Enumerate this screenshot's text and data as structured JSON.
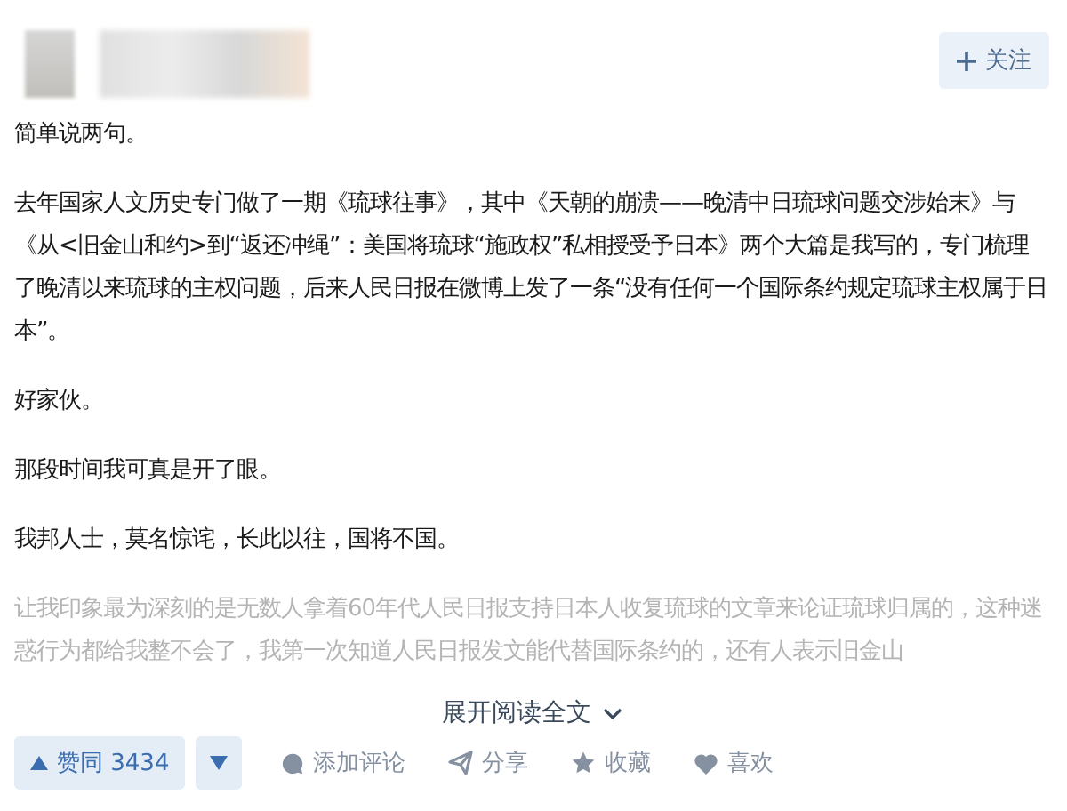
{
  "author": {
    "follow_label": "关注"
  },
  "paragraphs": [
    {
      "kind": "normal",
      "text": "简单说两句。"
    },
    {
      "kind": "normal",
      "text": "去年国家人文历史专门做了一期《琉球往事》，其中《天朝的崩溃——晚清中日琉球问题交涉始末》与《从<旧金山和约>到“返还冲绳”：美国将琉球“施政权”私相授受予日本》两个大篇是我写的，专门梳理了晚清以来琉球的主权问题，后来人民日报在微博上发了一条“没有任何一个国际条约规定琉球主权属于日本”。"
    },
    {
      "kind": "normal",
      "text": "好家伙。"
    },
    {
      "kind": "normal",
      "text": "那段时间我可真是开了眼。"
    },
    {
      "kind": "normal",
      "text": "我邦人士，莫名惊诧，长此以往，国将不国。"
    },
    {
      "kind": "faded",
      "text": "让我印象最为深刻的是无数人拿着60年代人民日报支持日本人收复琉球的文章来论证琉球归属的，这种迷惑行为都给我整不会了，我第一次知道人民日报发文能代替国际条约的，还有人表示旧金山"
    }
  ],
  "expand_label": "展开阅读全文",
  "actions": {
    "vote_label": "赞同 3434",
    "items": [
      {
        "kind": "comment",
        "label": "添加评论"
      },
      {
        "kind": "share",
        "label": "分享"
      },
      {
        "kind": "collect",
        "label": "收藏"
      },
      {
        "kind": "like",
        "label": "喜欢"
      }
    ]
  }
}
